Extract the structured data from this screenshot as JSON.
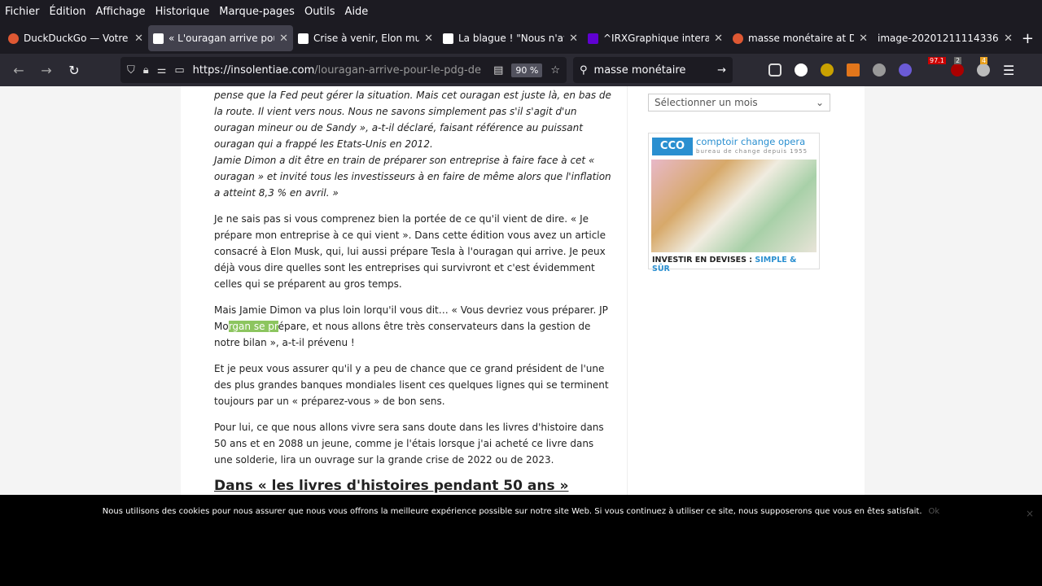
{
  "menu": [
    "Fichier",
    "Édition",
    "Affichage",
    "Historique",
    "Marque-pages",
    "Outils",
    "Aide"
  ],
  "tabs": [
    {
      "title": "DuckDuckGo — Votre",
      "icon": "duckduckgo-icon"
    },
    {
      "title": "« L'ouragan arrive pou",
      "icon": "site-icon",
      "active": true
    },
    {
      "title": "Crise à venir, Elon mu",
      "icon": "site-icon"
    },
    {
      "title": "La blague ! \"Nous n'av",
      "icon": "site-icon"
    },
    {
      "title": "^IRXGraphique intera",
      "icon": "yahoo-icon"
    },
    {
      "title": "masse monétaire at D",
      "icon": "duckduckgo-icon"
    },
    {
      "title": "image-20201211114336-",
      "icon": "image-icon"
    }
  ],
  "nav": {
    "url_domain": "https://insolentiae.com",
    "url_path": "/louragan-arrive-pour-le-pdg-de",
    "zoom": "90 %",
    "search": "masse monétaire",
    "badges": {
      "ext1": "97.1",
      "ext2": "2",
      "ext3": "4"
    }
  },
  "article": {
    "quote_lines": [
      "pense que la Fed peut gérer la situation. Mais cet ouragan est juste là, en bas de la route. Il vient vers nous. Nous ne savons simplement pas s'il s'agit d'un ouragan mineur ou de Sandy », a-t-il déclaré, faisant référence au puissant ouragan qui a frappé les Etats-Unis en 2012.",
      "Jamie Dimon a dit être en train de préparer son entreprise à faire face à cet « ouragan » et invité tous les investisseurs à en faire de même alors que l'inflation a atteint 8,3 % en avril. »"
    ],
    "p1": "Je ne sais pas si vous comprenez bien la portée de ce qu'il vient de dire. « Je prépare mon entreprise à ce qui vient ». Dans cette édition vous avez un article consacré à Elon Musk, qui, lui aussi prépare Tesla à l'ouragan qui arrive. Je peux déjà vous dire quelles sont les entreprises qui survivront et c'est évidemment celles qui se préparent au gros temps.",
    "p2_before": "Mais Jamie Dimon va plus loin lorqu'il vous dit… « Vous devriez vous préparer. JP Mo",
    "p2_selected": "rgan se pr",
    "p2_after": "épare, et nous allons être très conservateurs dans la gestion de notre bilan », a-t-il prévenu !",
    "p3": "Et je peux vous assurer qu'il y a peu de chance que ce grand président de l'une des plus grandes banques mondiales lisent ces quelques lignes qui se terminent toujours par un « préparez-vous » de bon sens.",
    "p4": "Pour lui, ce que nous allons vivre sera sans doute dans les livres d'histoire dans 50 ans et en 2088 un jeune, comme je l'étais lorsque j'ai acheté ce livre dans une solderie, lira un ouvrage sur la grande crise de 2022 ou de 2023.",
    "h2": "Dans « les livres d'histoires pendant 50 ans »"
  },
  "sidebar": {
    "month_select": "Sélectionner un mois",
    "ad": {
      "logo": "CCO",
      "brand": "comptoir change opera",
      "tagline": "bureau de change depuis 1955",
      "cta": "INVESTIR EN DEVISES :",
      "cta_accent": "SIMPLE & SÛR"
    }
  },
  "cookie": {
    "message": "Nous utilisons des cookies pour nous assurer que nous vous offrons la meilleure expérience possible sur notre site Web. Si vous continuez à utiliser ce site, nous supposerons que vous en êtes satisfait.",
    "ok": "Ok",
    "close": "×"
  },
  "colors": {
    "selection": "#8cc55f",
    "accent": "#2a8fd0"
  }
}
